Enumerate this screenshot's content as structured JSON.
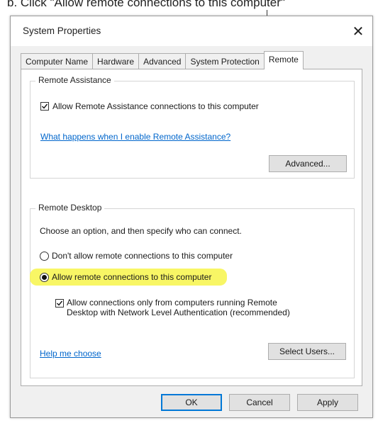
{
  "caption": "b. Click \"Allow remote connections to this computer\"",
  "window": {
    "title": "System Properties",
    "close_glyph": "✕"
  },
  "tabs": [
    {
      "label": "Computer Name",
      "active": false
    },
    {
      "label": "Hardware",
      "active": false
    },
    {
      "label": "Advanced",
      "active": false
    },
    {
      "label": "System Protection",
      "active": false
    },
    {
      "label": "Remote",
      "active": true
    }
  ],
  "remote_assistance": {
    "group_title": "Remote Assistance",
    "allow_label": "Allow Remote Assistance connections to this computer",
    "allow_checked": true,
    "help_link": "What happens when I enable Remote Assistance?",
    "advanced_button": "Advanced..."
  },
  "remote_desktop": {
    "group_title": "Remote Desktop",
    "instruction": "Choose an option, and then specify who can connect.",
    "option_disallow": "Don't allow remote connections to this computer",
    "option_allow": "Allow remote connections to this computer",
    "selected_option": "allow",
    "nla_label_line1": "Allow connections only from computers running Remote",
    "nla_label_line2": "Desktop with Network Level Authentication (recommended)",
    "nla_checked": true,
    "help_link": "Help me choose",
    "select_users_button": "Select Users..."
  },
  "footer": {
    "ok": "OK",
    "cancel": "Cancel",
    "apply": "Apply"
  },
  "colors": {
    "highlight": "#f7f54a",
    "link": "#0066cc"
  }
}
